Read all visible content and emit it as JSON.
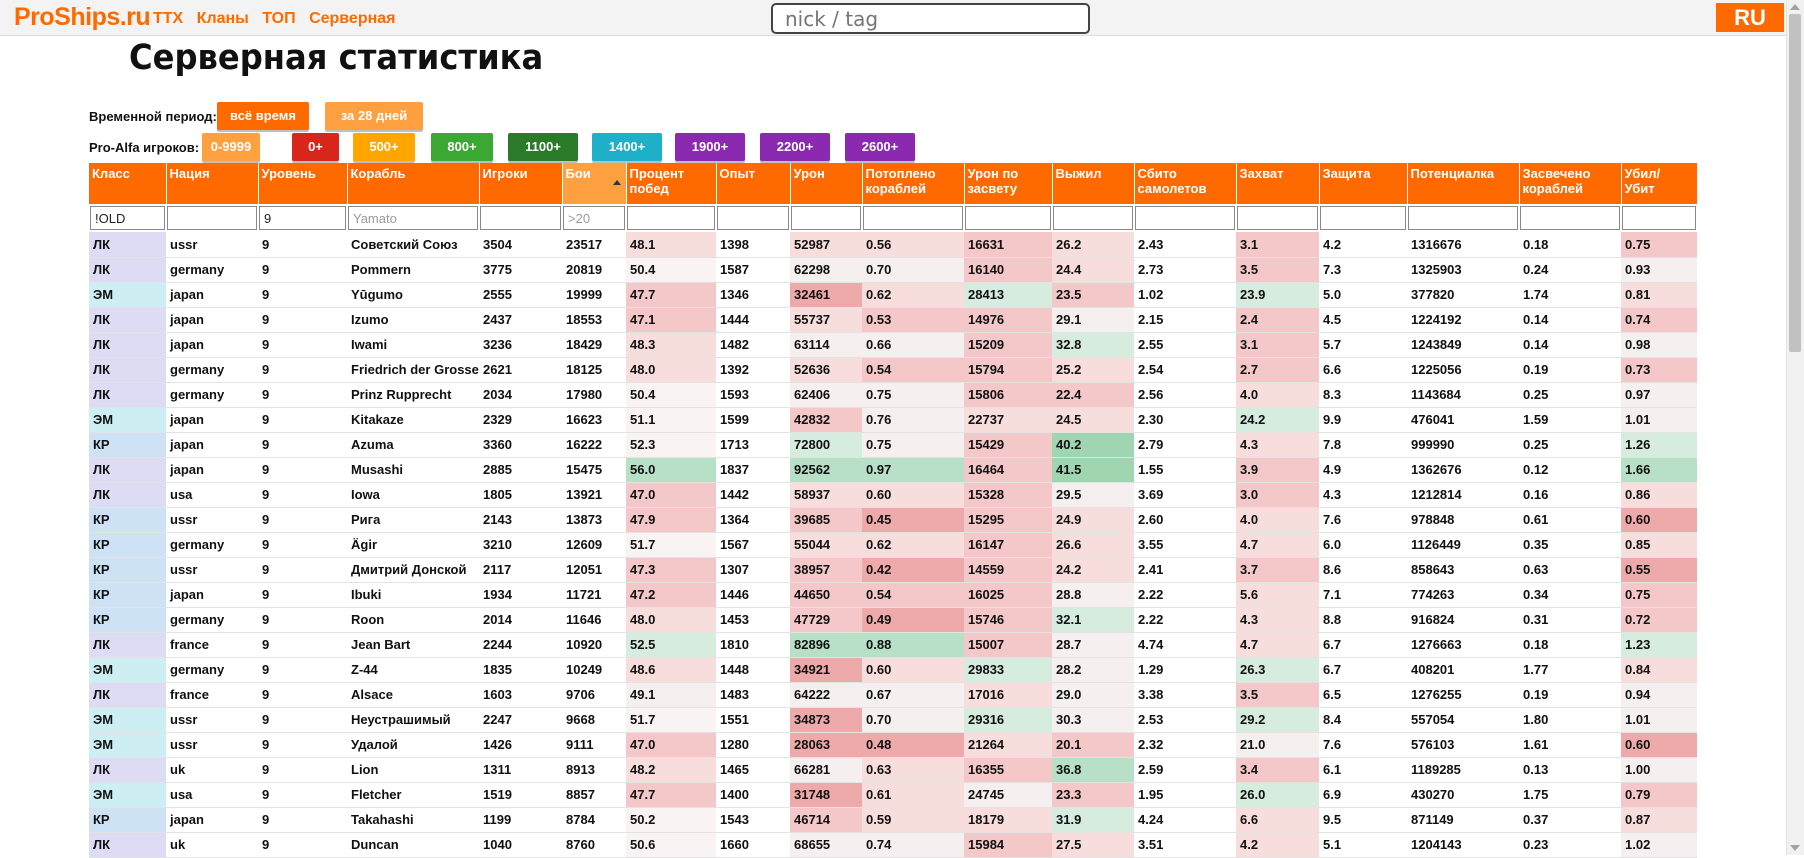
{
  "header": {
    "logo": "ProShips.ru",
    "nav": [
      "ТТХ",
      "Кланы",
      "ТОП",
      "Серверная"
    ],
    "search_placeholder": "nick / tag",
    "lang": "RU"
  },
  "title": "Серверная статистика",
  "period": {
    "label": "Временной период:",
    "buttons": [
      {
        "label": "всё время",
        "color": "#ff6a00"
      },
      {
        "label": "за 28 дней",
        "color": "#ffa040"
      }
    ]
  },
  "proalfa": {
    "label": "Pro-Alfa игроков:",
    "buttons": [
      {
        "label": "0-9999",
        "color": "#ffa040"
      },
      {
        "label": "0+",
        "color": "#d9261c"
      },
      {
        "label": "500+",
        "color": "#ffa600"
      },
      {
        "label": "800+",
        "color": "#3aa832"
      },
      {
        "label": "1100+",
        "color": "#2a7a2a"
      },
      {
        "label": "1400+",
        "color": "#1eb0c8"
      },
      {
        "label": "1900+",
        "color": "#8b2ab0"
      },
      {
        "label": "2200+",
        "color": "#8b2ab0"
      },
      {
        "label": "2600+",
        "color": "#8b2ab0"
      }
    ]
  },
  "table": {
    "columns": [
      "Класс",
      "Нация",
      "Уровень",
      "Корабль",
      "Игроки",
      "Бои",
      "Процент побед",
      "Опыт",
      "Урон",
      "Потоплено кораблей",
      "Урон по засвету",
      "Выжил",
      "Сбито самолетов",
      "Захват",
      "Защита",
      "Потенциалка",
      "Засвечено кораблей",
      "Убил/ Убит"
    ],
    "filters": {
      "class": "!OLD",
      "level": "9",
      "ship": "Yamato",
      "battles": ">20"
    },
    "rows": [
      [
        "ЛК",
        "ussr",
        "9",
        "Советский Союз",
        "3504",
        "23517",
        "48.1",
        "1398",
        "52987",
        "0.56",
        "16631",
        "26.2",
        "2.43",
        "3.1",
        "4.2",
        "1316676",
        "0.18",
        "0.75"
      ],
      [
        "ЛК",
        "germany",
        "9",
        "Pommern",
        "3775",
        "20819",
        "50.4",
        "1587",
        "62298",
        "0.70",
        "16140",
        "24.4",
        "2.73",
        "3.5",
        "7.3",
        "1325903",
        "0.24",
        "0.93"
      ],
      [
        "ЭМ",
        "japan",
        "9",
        "Yūgumo",
        "2555",
        "19999",
        "47.7",
        "1346",
        "32461",
        "0.62",
        "28413",
        "23.5",
        "1.02",
        "23.9",
        "5.0",
        "377820",
        "1.74",
        "0.81"
      ],
      [
        "ЛК",
        "japan",
        "9",
        "Izumo",
        "2437",
        "18553",
        "47.1",
        "1444",
        "55737",
        "0.53",
        "14976",
        "29.1",
        "2.15",
        "2.4",
        "4.5",
        "1224192",
        "0.14",
        "0.74"
      ],
      [
        "ЛК",
        "japan",
        "9",
        "Iwami",
        "3236",
        "18429",
        "48.3",
        "1482",
        "63114",
        "0.66",
        "15209",
        "32.8",
        "2.55",
        "3.1",
        "5.7",
        "1243849",
        "0.14",
        "0.98"
      ],
      [
        "ЛК",
        "germany",
        "9",
        "Friedrich der Grosse",
        "2621",
        "18125",
        "48.0",
        "1392",
        "52636",
        "0.54",
        "15794",
        "25.2",
        "2.54",
        "2.7",
        "6.6",
        "1225056",
        "0.19",
        "0.73"
      ],
      [
        "ЛК",
        "germany",
        "9",
        "Prinz Rupprecht",
        "2034",
        "17980",
        "50.4",
        "1593",
        "62406",
        "0.75",
        "15806",
        "22.4",
        "2.56",
        "4.0",
        "8.3",
        "1143684",
        "0.25",
        "0.97"
      ],
      [
        "ЭМ",
        "japan",
        "9",
        "Kitakaze",
        "2329",
        "16623",
        "51.1",
        "1599",
        "42832",
        "0.76",
        "22737",
        "24.5",
        "2.30",
        "24.2",
        "9.9",
        "476041",
        "1.59",
        "1.01"
      ],
      [
        "КР",
        "japan",
        "9",
        "Azuma",
        "3360",
        "16222",
        "52.3",
        "1713",
        "72800",
        "0.75",
        "15429",
        "40.2",
        "2.79",
        "4.3",
        "7.8",
        "999990",
        "0.25",
        "1.26"
      ],
      [
        "ЛК",
        "japan",
        "9",
        "Musashi",
        "2885",
        "15475",
        "56.0",
        "1837",
        "92562",
        "0.97",
        "16464",
        "41.5",
        "1.55",
        "3.9",
        "4.9",
        "1362676",
        "0.12",
        "1.66"
      ],
      [
        "ЛК",
        "usa",
        "9",
        "Iowa",
        "1805",
        "13921",
        "47.0",
        "1442",
        "58937",
        "0.60",
        "15328",
        "29.5",
        "3.69",
        "3.0",
        "4.3",
        "1212814",
        "0.16",
        "0.86"
      ],
      [
        "КР",
        "ussr",
        "9",
        "Рига",
        "2143",
        "13873",
        "47.9",
        "1364",
        "39685",
        "0.45",
        "15295",
        "24.9",
        "2.60",
        "4.0",
        "7.6",
        "978848",
        "0.61",
        "0.60"
      ],
      [
        "КР",
        "germany",
        "9",
        "Ägir",
        "3210",
        "12609",
        "51.7",
        "1567",
        "55044",
        "0.62",
        "16147",
        "26.6",
        "3.55",
        "4.7",
        "6.0",
        "1126449",
        "0.35",
        "0.85"
      ],
      [
        "КР",
        "ussr",
        "9",
        "Дмитрий Донской",
        "2117",
        "12051",
        "47.3",
        "1307",
        "38957",
        "0.42",
        "14559",
        "24.2",
        "2.41",
        "3.7",
        "8.6",
        "858643",
        "0.63",
        "0.55"
      ],
      [
        "КР",
        "japan",
        "9",
        "Ibuki",
        "1934",
        "11721",
        "47.2",
        "1446",
        "44650",
        "0.54",
        "16025",
        "28.8",
        "2.22",
        "5.6",
        "7.1",
        "774263",
        "0.34",
        "0.75"
      ],
      [
        "КР",
        "germany",
        "9",
        "Roon",
        "2014",
        "11646",
        "48.0",
        "1453",
        "47729",
        "0.49",
        "15746",
        "32.1",
        "2.22",
        "4.3",
        "8.8",
        "916824",
        "0.31",
        "0.72"
      ],
      [
        "ЛК",
        "france",
        "9",
        "Jean Bart",
        "2244",
        "10920",
        "52.5",
        "1810",
        "82896",
        "0.88",
        "15007",
        "28.7",
        "4.74",
        "4.7",
        "6.7",
        "1276663",
        "0.18",
        "1.23"
      ],
      [
        "ЭМ",
        "germany",
        "9",
        "Z-44",
        "1835",
        "10249",
        "48.6",
        "1448",
        "34921",
        "0.60",
        "29833",
        "28.2",
        "1.29",
        "26.3",
        "6.7",
        "408201",
        "1.77",
        "0.84"
      ],
      [
        "ЛК",
        "france",
        "9",
        "Alsace",
        "1603",
        "9706",
        "49.1",
        "1483",
        "64222",
        "0.67",
        "17016",
        "29.0",
        "3.38",
        "3.5",
        "6.5",
        "1276255",
        "0.19",
        "0.94"
      ],
      [
        "ЭМ",
        "ussr",
        "9",
        "Неустрашимый",
        "2247",
        "9668",
        "51.7",
        "1551",
        "34873",
        "0.70",
        "29316",
        "30.3",
        "2.53",
        "29.2",
        "8.4",
        "557054",
        "1.80",
        "1.01"
      ],
      [
        "ЭМ",
        "ussr",
        "9",
        "Удалой",
        "1426",
        "9111",
        "47.0",
        "1280",
        "28063",
        "0.48",
        "21264",
        "20.1",
        "2.32",
        "21.0",
        "7.6",
        "576103",
        "1.61",
        "0.60"
      ],
      [
        "ЛК",
        "uk",
        "9",
        "Lion",
        "1311",
        "8913",
        "48.2",
        "1465",
        "66281",
        "0.63",
        "16355",
        "36.8",
        "2.59",
        "3.4",
        "6.1",
        "1189285",
        "0.13",
        "1.00"
      ],
      [
        "ЭМ",
        "usa",
        "9",
        "Fletcher",
        "1519",
        "8857",
        "47.7",
        "1400",
        "31748",
        "0.61",
        "24745",
        "23.3",
        "1.95",
        "26.0",
        "6.9",
        "430270",
        "1.75",
        "0.79"
      ],
      [
        "КР",
        "japan",
        "9",
        "Takahashi",
        "1199",
        "8784",
        "50.2",
        "1543",
        "46714",
        "0.59",
        "18179",
        "31.9",
        "4.24",
        "6.6",
        "9.5",
        "871149",
        "0.37",
        "0.87"
      ],
      [
        "ЛК",
        "uk",
        "9",
        "Duncan",
        "1040",
        "8760",
        "50.6",
        "1660",
        "68655",
        "0.74",
        "15984",
        "27.5",
        "3.51",
        "4.2",
        "5.1",
        "1204143",
        "0.23",
        "1.02"
      ]
    ],
    "cell_colors": {
      "red_strong": "#eeaaaa",
      "red_mid": "#f4c8c8",
      "red_light": "#f8dddd",
      "neutral": "#f5efef",
      "green_light": "#d6ecde",
      "green_mid": "#b8e0c6",
      "green_strong": "#9fd6b1"
    }
  }
}
